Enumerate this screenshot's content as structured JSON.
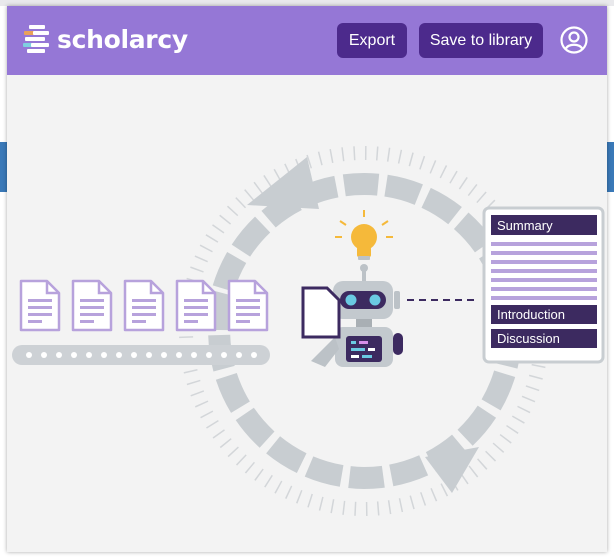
{
  "app": {
    "brand_name": "scholarcy",
    "accent_color": "#9577d6",
    "button_color": "#4c2a8c"
  },
  "header": {
    "export_label": "Export",
    "save_label": "Save to library",
    "avatar_icon": "user-circle-icon"
  },
  "illustration": {
    "summary_card": {
      "summary_label": "Summary",
      "introduction_label": "Introduction",
      "discussion_label": "Discussion"
    },
    "document_count": 5,
    "icons": [
      "document-icon",
      "robot-icon",
      "lightbulb-icon",
      "cycle-arrow-icon",
      "conveyor-belt-icon"
    ]
  }
}
